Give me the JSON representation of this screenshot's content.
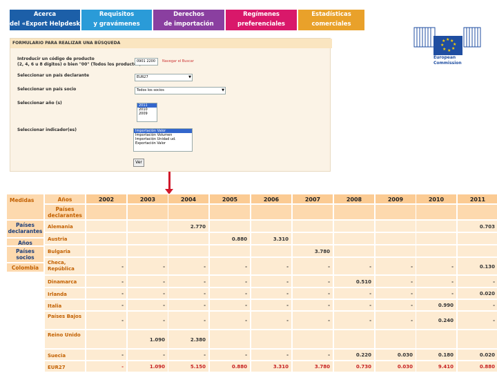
{
  "nav": {
    "tabs": [
      {
        "line1": "Acerca",
        "line2": "del «Export Helpdesk»",
        "color": "#1c5fa8"
      },
      {
        "line1": "Requisitos",
        "line2": "y gravámenes",
        "color": "#2a9bd8"
      },
      {
        "line1": "Derechos",
        "line2": "de importación",
        "color": "#8a3fa0"
      },
      {
        "line1": "Regímenes",
        "line2": "preferenciales",
        "color": "#d9186a"
      },
      {
        "line1": "Estadísticas",
        "line2": "comerciales",
        "color": "#e9a12a"
      }
    ]
  },
  "logo": {
    "line1": "European",
    "line2": "Commission"
  },
  "form": {
    "title": "FORMULARIO PARA REALIZAR UNA BÚSQUEDA",
    "product_label_1": "Introducir un código de producto",
    "product_label_2": "(2, 4, 6 u 8 dígitos) o bien \"00\" (Todos los productos)",
    "product_value": "0901 2200",
    "browse_link": "Navegar el Buscar",
    "reporter_label": "Seleccionar un país declarante",
    "reporter_value": "EUR27",
    "partner_label": "Seleccionar un país socio",
    "partner_value": "Todos los socios",
    "year_label": "Seleccionar año (s)",
    "years": [
      "2011",
      "2010",
      "2009"
    ],
    "indicator_label": "Seleccionar indicador(es)",
    "indicators": [
      "Importación Valor",
      "Importación Volumen",
      "Importación Unidad ud.",
      "Exportación Valor"
    ],
    "submit": "Ver"
  },
  "table": {
    "corner_top": "Medidas",
    "corner_years": "Años",
    "corner_reporters": "Países declarantes",
    "side_labels": [
      "Países declarantes",
      "Años",
      "Países socios",
      "Colombia"
    ],
    "years": [
      "2002",
      "2003",
      "2004",
      "2005",
      "2006",
      "2007",
      "2008",
      "2009",
      "2010",
      "2011"
    ],
    "rows": [
      {
        "country": "Alemania",
        "values": [
          "",
          "",
          "2.770",
          "",
          "",
          "",
          "",
          "",
          "",
          "0.703"
        ]
      },
      {
        "country": "Austria",
        "values": [
          "",
          "",
          "",
          "0.880",
          "3.310",
          "",
          "",
          "",
          "",
          ""
        ]
      },
      {
        "country": "Bulgaria",
        "values": [
          "",
          "",
          "",
          "",
          "",
          "3.780",
          "",
          "",
          "",
          ""
        ]
      },
      {
        "country": "Checa, República",
        "values": [
          "-",
          "-",
          "-",
          "-",
          "-",
          "-",
          "-",
          "-",
          "-",
          "0.130"
        ]
      },
      {
        "country": "Dinamarca",
        "values": [
          "-",
          "-",
          "-",
          "-",
          "-",
          "-",
          "0.510",
          "-",
          "-",
          "-"
        ]
      },
      {
        "country": "Irlanda",
        "values": [
          "-",
          "-",
          "-",
          "-",
          "-",
          "-",
          "-",
          "-",
          "-",
          "0.020"
        ]
      },
      {
        "country": "Italia",
        "values": [
          "-",
          "-",
          "-",
          "-",
          "-",
          "-",
          "-",
          "-",
          "0.990",
          "-"
        ]
      },
      {
        "country": "Países Bajos",
        "values": [
          "-",
          "-",
          "-",
          "-",
          "-",
          "-",
          "-",
          "-",
          "0.240",
          "-"
        ]
      },
      {
        "country": "Reino Unido",
        "values": [
          "",
          "1.090",
          "2.380",
          "",
          "",
          "",
          "",
          "",
          "",
          ""
        ]
      },
      {
        "country": "Suecia",
        "values": [
          "-",
          "-",
          "-",
          "-",
          "-",
          "-",
          "0.220",
          "0.030",
          "0.180",
          "0.020"
        ]
      },
      {
        "country": "EUR27",
        "values": [
          "-",
          "1.090",
          "5.150",
          "0.880",
          "3.310",
          "3.780",
          "0.730",
          "0.030",
          "9.410",
          "0.880"
        ]
      }
    ]
  }
}
